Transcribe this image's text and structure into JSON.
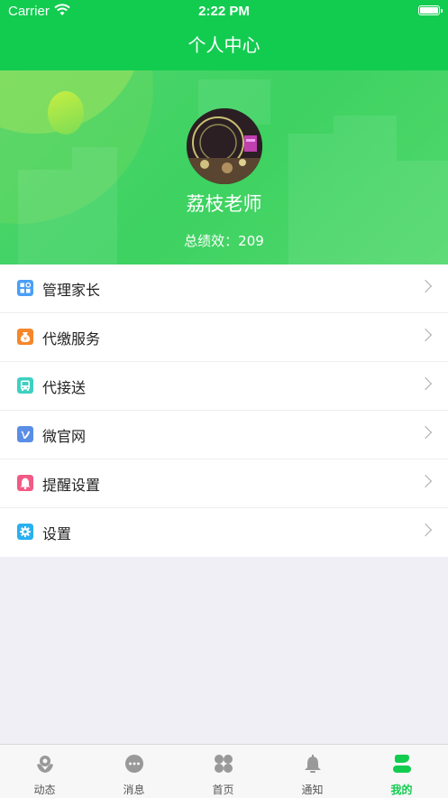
{
  "status_bar": {
    "carrier": "Carrier",
    "time": "2:22 PM"
  },
  "navbar": {
    "title": "个人中心"
  },
  "profile": {
    "name": "荔枝老师",
    "score": "总绩效：209"
  },
  "menu": [
    {
      "label": "管理家长",
      "icon": "grid-icon",
      "color": "#4a9ff5"
    },
    {
      "label": "代缴服务",
      "icon": "money-bag-icon",
      "color": "#f5872a"
    },
    {
      "label": "代接送",
      "icon": "bus-icon",
      "color": "#3fd0c1"
    },
    {
      "label": "微官网",
      "icon": "v-logo-icon",
      "color": "#5a8ee6"
    },
    {
      "label": "提醒设置",
      "icon": "bell-icon",
      "color": "#f25a86"
    },
    {
      "label": "设置",
      "icon": "gear-icon",
      "color": "#2ab0f0"
    }
  ],
  "tabs": [
    {
      "label": "动态",
      "icon": "trends-icon",
      "active": false
    },
    {
      "label": "消息",
      "icon": "chat-bubble-icon",
      "active": false
    },
    {
      "label": "首页",
      "icon": "home-clover-icon",
      "active": false
    },
    {
      "label": "通知",
      "icon": "bell-icon",
      "active": false
    },
    {
      "label": "我的",
      "icon": "person-icon",
      "active": true
    }
  ],
  "colors": {
    "primary": "#12cc50",
    "tab_inactive": "#999999"
  }
}
